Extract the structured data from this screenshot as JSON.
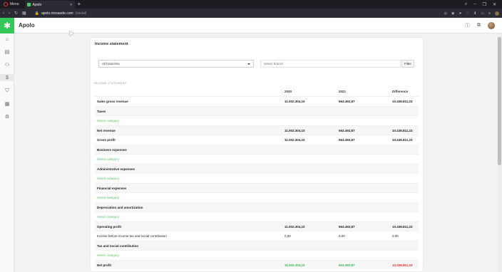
{
  "browser": {
    "menu_label": "Menu",
    "tab_title": "Apolo",
    "url_domain": "apolo.ninsaude.com",
    "url_path": "/social/"
  },
  "app": {
    "title": "Apolo"
  },
  "card": {
    "title": "Income statement",
    "branch_select_value": "All branches",
    "search_placeholder": "Select branch",
    "filter_label": "Filter",
    "section_label": "INCOME STATEMENT"
  },
  "columns": [
    "2020",
    "2021",
    "Difference"
  ],
  "rows": [
    {
      "label": "Sales gross revenue",
      "v1": "11.002.304,10",
      "v2": "563.492,87",
      "v3": "10.438.811,23"
    },
    {
      "label": "Taxes",
      "v1": "",
      "v2": "",
      "v3": ""
    },
    {
      "label": "Select category",
      "v1": "",
      "v2": "",
      "v3": ""
    },
    {
      "label": "Net revenue",
      "v1": "11.002.304,10",
      "v2": "563.492,87",
      "v3": "10.438.811,23"
    },
    {
      "label": "Gross profit",
      "v1": "11.002.304,10",
      "v2": "563.492,87",
      "v3": "10.438.811,23"
    },
    {
      "label": "Business expenses",
      "v1": "",
      "v2": "",
      "v3": ""
    },
    {
      "label": "Select category",
      "v1": "",
      "v2": "",
      "v3": ""
    },
    {
      "label": "Administrative expenses",
      "v1": "",
      "v2": "",
      "v3": ""
    },
    {
      "label": "Select category",
      "v1": "",
      "v2": "",
      "v3": ""
    },
    {
      "label": "Financial expenses",
      "v1": "",
      "v2": "",
      "v3": ""
    },
    {
      "label": "Select category",
      "v1": "",
      "v2": "",
      "v3": ""
    },
    {
      "label": "Depreciation and amortization",
      "v1": "",
      "v2": "",
      "v3": ""
    },
    {
      "label": "Select category",
      "v1": "",
      "v2": "",
      "v3": ""
    },
    {
      "label": "Operating profit",
      "v1": "11.002.304,10",
      "v2": "563.492,87",
      "v3": "10.438.811,23"
    },
    {
      "label": "Income before income tax and social contribution",
      "v1": "0,00",
      "v2": "0,00",
      "v3": "0,00"
    },
    {
      "label": "Tax and social contribution",
      "v1": "",
      "v2": "",
      "v3": ""
    },
    {
      "label": "Select category",
      "v1": "",
      "v2": "",
      "v3": ""
    },
    {
      "label": "Net profit",
      "v1": "11.002.304,10",
      "v2": "563.492,87",
      "v3": "10.438.811,23"
    }
  ],
  "colors": {
    "brand": "#34c85a",
    "link": "#5cc46a",
    "positive": "#3cb95a",
    "negative": "#e0322c"
  },
  "icons": {
    "sidebar": [
      "home-icon",
      "calendar-icon",
      "people-icon",
      "dollar-icon",
      "bag-icon",
      "table-icon",
      "gear-icon"
    ],
    "header": [
      "help-icon",
      "chat-icon",
      "user-avatar"
    ]
  }
}
